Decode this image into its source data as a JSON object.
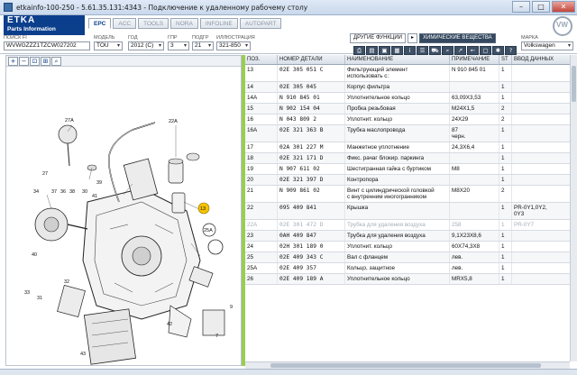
{
  "window": {
    "title": "etkainfo-100-250 - 5.61.35.131:4343 - Подключение к удаленному рабочему столу"
  },
  "app": {
    "logo_text": "ETKA",
    "logo_sub": "Parts Information"
  },
  "tabs": [
    {
      "label": "EPC",
      "active": true
    },
    {
      "label": "ACC",
      "active": false
    },
    {
      "label": "TOOLS",
      "active": false
    },
    {
      "label": "NORA",
      "active": false
    },
    {
      "label": "INFOLINE",
      "active": false
    },
    {
      "label": "AUTOPART",
      "active": false
    }
  ],
  "fields": {
    "search_fi_label": "ПОИСК FI",
    "search_fi_value": "WVWGZZZ1TZCW027202",
    "model_label": "МОДЕЛЬ",
    "model_value": "TOU",
    "year_label": "ГОД",
    "year_value": "2012 (C)",
    "group_label": "ГПР",
    "group_value": "3",
    "subgroup_label": "ПОДГР",
    "subgroup_value": "21",
    "illustration_label": "ИЛЛЮСТРАЦИЯ",
    "illustration_value": "321-850",
    "brand_label": "МАРКА",
    "brand_value": "Volkswagen"
  },
  "functions": {
    "other_functions": "ДРУГИЕ ФУНКЦИИ",
    "arrow": "▸",
    "chemicals": "ХИМИЧЕСКИЕ ВЕЩЕСТВА"
  },
  "table": {
    "headers": {
      "pos": "ПОЗ.",
      "part": "НОМЕР ДЕТАЛИ",
      "name": "НАИМЕНОВАНИЕ",
      "note": "ПРИМЕЧАНИЕ",
      "st": "ST",
      "data": "ВВОД ДАННЫХ"
    },
    "rows": [
      {
        "pos": "13",
        "part": "02E  305 051 C",
        "name": "Фильтрующий элемент\n         использовать с:",
        "note": "N   910 845 01",
        "st": "1",
        "data": ""
      },
      {
        "pos": "14",
        "part": "02E  305 045",
        "name": "Корпус фильтра",
        "note": "",
        "st": "1",
        "data": ""
      },
      {
        "pos": "14A",
        "part": "N    910 845 01",
        "name": "Уплотнительное кольцо",
        "note": "63,09X3,53",
        "st": "1",
        "data": ""
      },
      {
        "pos": "15",
        "part": "N    902 154 04",
        "name": "Пробка резьбовая",
        "note": "M24X1,5",
        "st": "2",
        "data": ""
      },
      {
        "pos": "16",
        "part": "N    043 809 2",
        "name": "Уплотнит. кольцо",
        "note": "24X29",
        "st": "2",
        "data": ""
      },
      {
        "pos": "16A",
        "part": "02E  321 363 B",
        "name": "Трубка маслопровода",
        "note": "87\nчерн.",
        "st": "1",
        "data": ""
      },
      {
        "pos": "17",
        "part": "02A  301 227 M",
        "name": "Манжетное уплотнение",
        "note": "24,3X6,4",
        "st": "1",
        "data": ""
      },
      {
        "pos": "18",
        "part": "02E  321 171 D",
        "name": "Фикс. рачаг блокир. паркинга",
        "note": "",
        "st": "1",
        "data": ""
      },
      {
        "pos": "19",
        "part": "N    907 611 02",
        "name": "Шестигранная гайка с буртиком",
        "note": "M8",
        "st": "1",
        "data": ""
      },
      {
        "pos": "20",
        "part": "02E  321 397 D",
        "name": "Контропора",
        "note": "",
        "st": "1",
        "data": ""
      },
      {
        "pos": "21",
        "part": "N    909 861 02",
        "name": "Винт с цилиндрической головкой\nс внутренним иногогранником",
        "note": "M8X20",
        "st": "2",
        "data": ""
      },
      {
        "pos": "22",
        "part": "095  409 841",
        "name": "Крышка",
        "note": "",
        "st": "1",
        "data": "PR-0Y1,0Y2,\n0Y3"
      },
      {
        "pos": "22A",
        "part": "02E  301 472 D",
        "name": "Трубка для удаления воздуха",
        "note": "258",
        "st": "1",
        "data": "PR-0Y7",
        "dim": true
      },
      {
        "pos": "23",
        "part": "0AH  409 847",
        "name": "Трубка для удаления воздуха",
        "note": "9,1X23X8,6",
        "st": "1",
        "data": ""
      },
      {
        "pos": "24",
        "part": "02H  301 189 0",
        "name": "Уплотнит. кольцо",
        "note": "60X74,3X8",
        "st": "1",
        "data": ""
      },
      {
        "pos": "25",
        "part": "02E  409 343 C",
        "name": "Вал с фланцем",
        "note": "лев.",
        "st": "1",
        "data": ""
      },
      {
        "pos": "25A",
        "part": "02E  409 357",
        "name": "Кольцо, защитное",
        "note": "лев.",
        "st": "1",
        "data": ""
      },
      {
        "pos": "26",
        "part": "02E  409 189 A",
        "name": "Уплотнительное кольцо",
        "note": "MRX5,8",
        "st": "1",
        "data": ""
      }
    ]
  },
  "diagram": {
    "callouts": [
      "27A",
      "22A",
      "27",
      "37",
      "36",
      "38",
      "30",
      "39",
      "41",
      "40",
      "31",
      "34",
      "32",
      "33",
      "25A",
      "13",
      "42",
      "43",
      "9",
      "7"
    ]
  }
}
